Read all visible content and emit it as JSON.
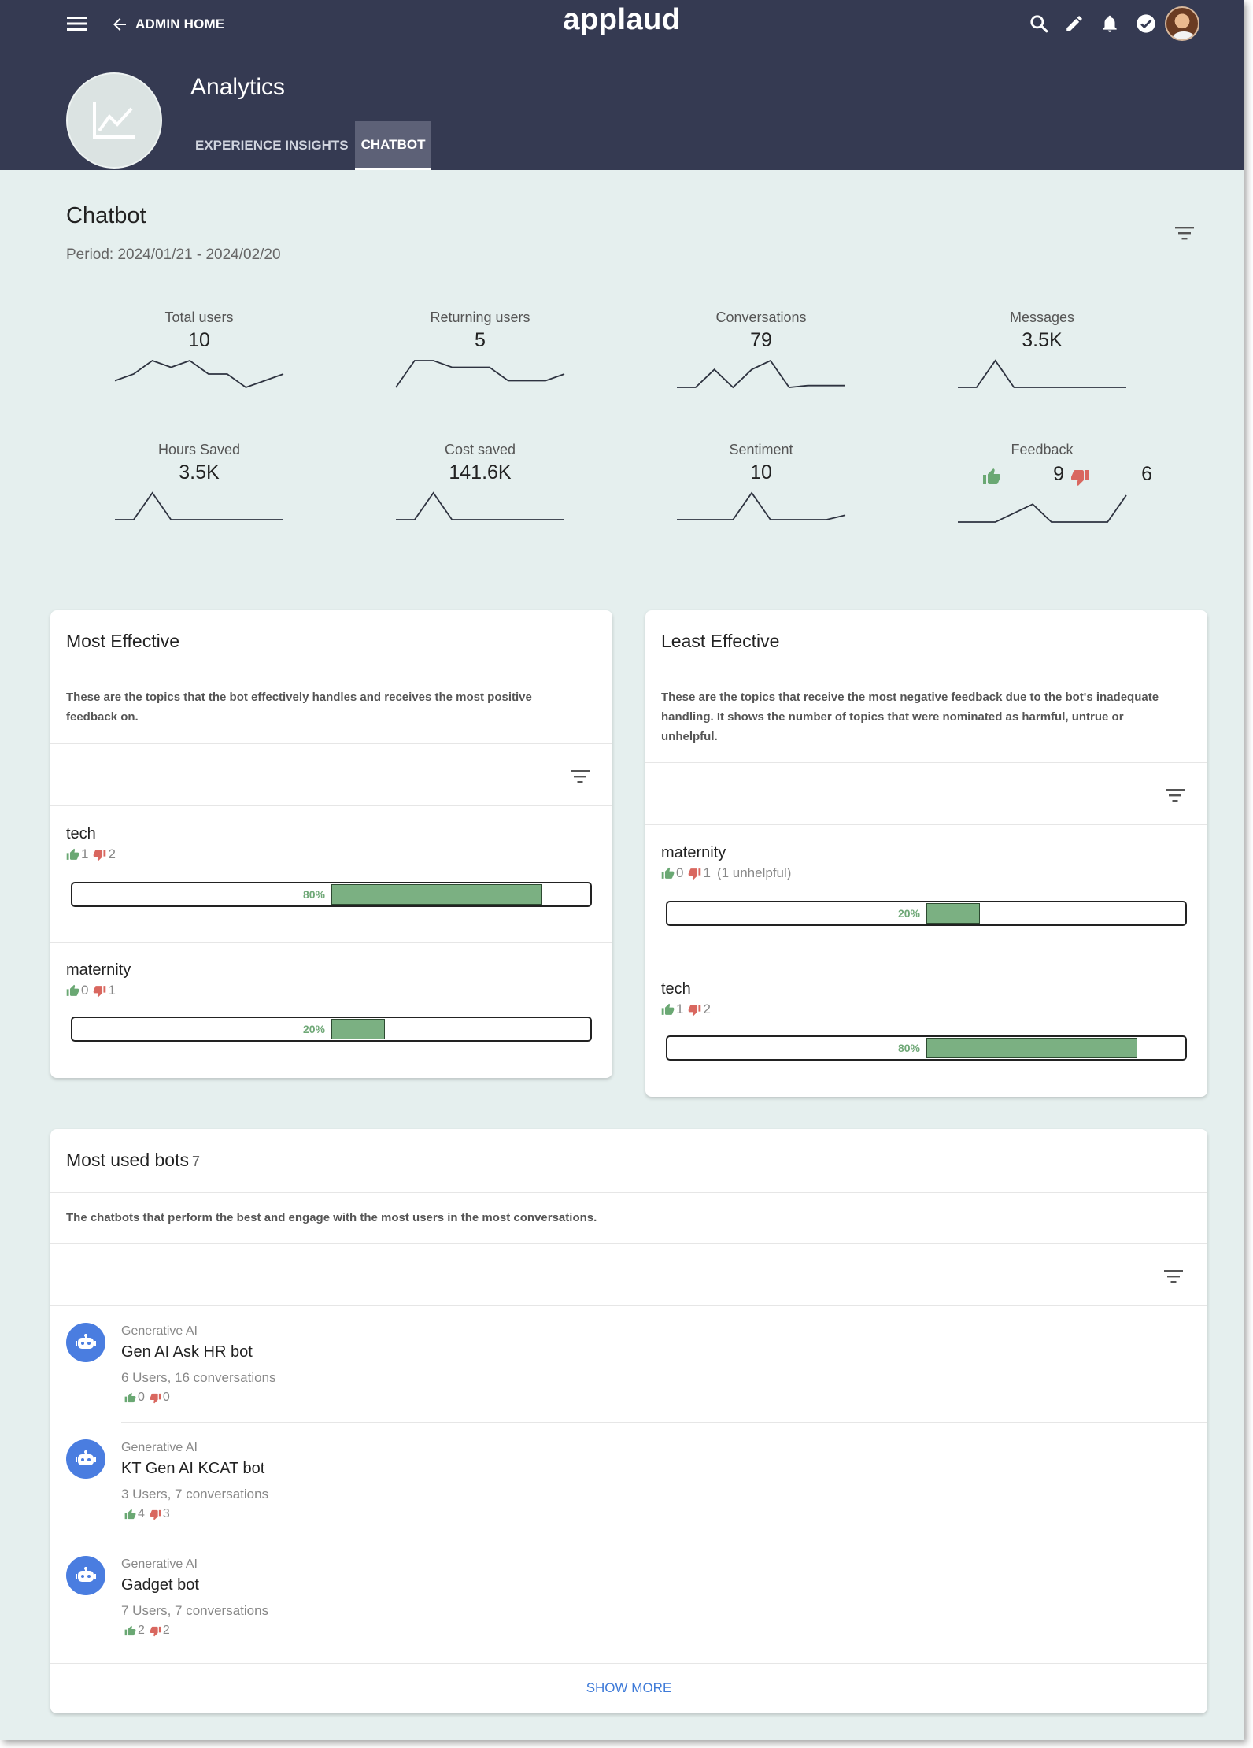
{
  "header": {
    "back_label": "ADMIN HOME",
    "brand": "applaud",
    "page_title": "Analytics",
    "tabs": [
      {
        "label": "EXPERIENCE INSIGHTS",
        "active": false
      },
      {
        "label": "CHATBOT",
        "active": true
      }
    ],
    "icons": [
      "menu-icon",
      "arrow-left-icon",
      "search-icon",
      "pencil-icon",
      "bell-icon",
      "check-circle-icon",
      "chart-line-icon"
    ]
  },
  "summary": {
    "title": "Chatbot",
    "period": "Period: 2024/01/21 - 2024/02/20",
    "stats": [
      {
        "label": "Total users",
        "value": "10",
        "trend": [
          2,
          3,
          5,
          4,
          5,
          3,
          3,
          1,
          2,
          3
        ]
      },
      {
        "label": "Returning users",
        "value": "5",
        "trend": [
          0,
          2,
          2,
          1.5,
          1.5,
          1.5,
          0.5,
          0.5,
          0.5,
          1
        ]
      },
      {
        "label": "Conversations",
        "value": "79",
        "trend": [
          0,
          0,
          2,
          0,
          2,
          3,
          0,
          0.2,
          0.2,
          0.2
        ]
      },
      {
        "label": "Messages",
        "value": "3.5K",
        "trend": [
          0,
          0,
          3,
          0,
          0,
          0,
          0,
          0,
          0,
          0
        ]
      },
      {
        "label": "Hours Saved",
        "value": "3.5K",
        "trend": [
          0,
          0,
          3,
          0,
          0,
          0,
          0,
          0,
          0,
          0
        ]
      },
      {
        "label": "Cost saved",
        "value": "141.6K",
        "trend": [
          0,
          0,
          3,
          0,
          0,
          0,
          0,
          0,
          0,
          0
        ]
      },
      {
        "label": "Sentiment",
        "value": "10",
        "trend": [
          0,
          0,
          0,
          0,
          3,
          0,
          0,
          0,
          0,
          0.5
        ]
      },
      {
        "label": "Feedback",
        "up": "9",
        "down": "6",
        "trend": [
          0,
          0,
          0,
          1,
          2,
          0,
          0,
          0,
          0,
          3
        ]
      }
    ]
  },
  "most_effective": {
    "title": "Most Effective",
    "description": "These are the topics that the bot effectively handles and receives the most positive feedback on.",
    "topics": [
      {
        "name": "tech",
        "up": "1",
        "down": "2",
        "note": "",
        "percent": 80,
        "percent_label": "80%"
      },
      {
        "name": "maternity",
        "up": "0",
        "down": "1",
        "note": "",
        "percent": 20,
        "percent_label": "20%"
      }
    ]
  },
  "least_effective": {
    "title": "Least Effective",
    "description": "These are the topics that receive the most negative feedback due to the bot's inadequate handling. It shows the number of topics that were nominated as harmful, untrue or unhelpful.",
    "topics": [
      {
        "name": "maternity",
        "up": "0",
        "down": "1",
        "note": "(1 unhelpful)",
        "percent": 20,
        "percent_label": "20%"
      },
      {
        "name": "tech",
        "up": "1",
        "down": "2",
        "note": "",
        "percent": 80,
        "percent_label": "80%"
      }
    ]
  },
  "most_used": {
    "title": "Most used bots",
    "count": "7",
    "description": "The chatbots that perform the best and engage with the most users in the most conversations.",
    "bots": [
      {
        "type": "Generative AI",
        "name": "Gen AI Ask HR bot",
        "meta": "6 Users, 16 conversations",
        "up": "0",
        "down": "0"
      },
      {
        "type": "Generative AI",
        "name": "KT Gen AI KCAT bot",
        "meta": "3 Users, 7 conversations",
        "up": "4",
        "down": "3"
      },
      {
        "type": "Generative AI",
        "name": "Gadget bot",
        "meta": "7 Users, 7 conversations",
        "up": "2",
        "down": "2"
      }
    ],
    "show_more": "SHOW MORE"
  },
  "colors": {
    "header_bg": "#353a52",
    "page_bg": "#e5efee",
    "bar_fill": "#7bb082",
    "thumb_up": "#6aa873",
    "thumb_down": "#d9675f",
    "bot_icon": "#4a7de0",
    "link": "#3f7bd8"
  }
}
